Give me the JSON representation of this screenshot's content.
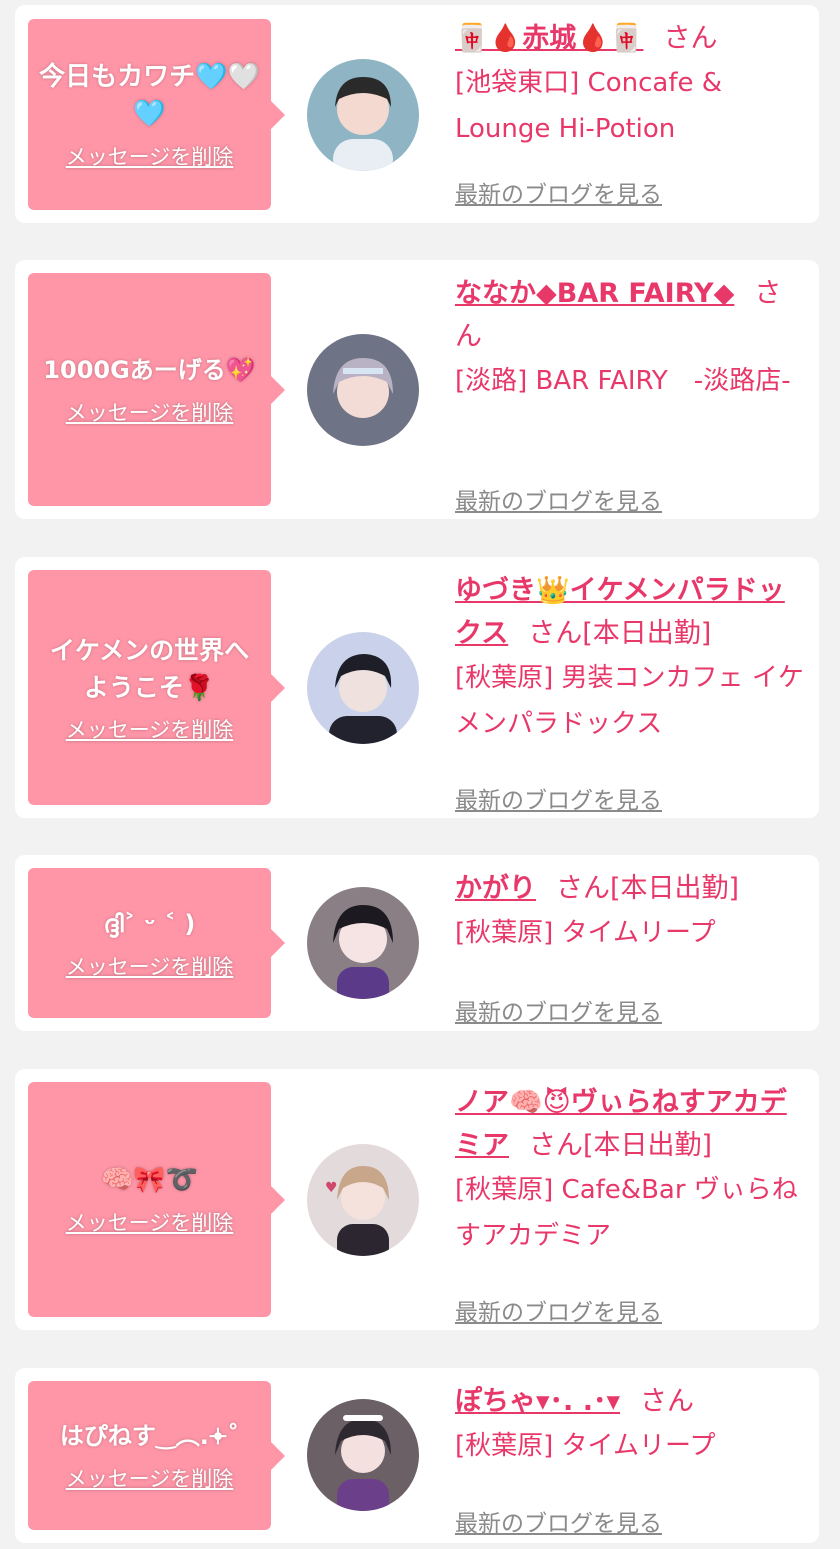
{
  "cards": [
    {
      "message": "今日もカワチ🩵🤍🩵",
      "delete_label": "メッセージを削除",
      "name": "🀄🩸赤城🩸🀄",
      "honorific": "さん",
      "badge": "",
      "shop": "[池袋東口] Concafe & Lounge Hi-Potion",
      "blog_label": "最新のブログを見る"
    },
    {
      "message": "1000Gあーげる💖",
      "delete_label": "メッセージを削除",
      "name": "ななか◆BAR FAIRY◆",
      "honorific": "さん",
      "badge": "",
      "shop": "[淡路] BAR FAIRY　-淡路店-",
      "blog_label": "最新のブログを見る"
    },
    {
      "message": "イケメンの世界へようこそ🌹",
      "delete_label": "メッセージを削除",
      "name": "ゆづき👑イケメンパラドックス",
      "honorific": "さん",
      "badge": "[本日出勤]",
      "shop": "[秋葉原] 男装コンカフェ イケメンパラドックス",
      "blog_label": "最新のブログを見る"
    },
    {
      "message": "ദ്ദി˃ ᵕ ˂ )",
      "delete_label": "メッセージを削除",
      "name": "かがり",
      "honorific": "さん",
      "badge": "[本日出勤]",
      "shop": "[秋葉原] タイムリープ",
      "blog_label": "最新のブログを見る"
    },
    {
      "message": "🧠🎀➰",
      "delete_label": "メッセージを削除",
      "name": "ノア🧠😈ヴぃらねすアカデミア",
      "honorific": "さん",
      "badge": "[本日出勤]",
      "shop": "[秋葉原] Cafe&Bar ヴぃらねすアカデミア",
      "blog_label": "最新のブログを見る"
    },
    {
      "message": "はぴねす‿︵.𖥔˚",
      "delete_label": "メッセージを削除",
      "name": "ぽちゃ▾･. .･▾",
      "honorific": "さん",
      "badge": "",
      "shop": "[秋葉原] タイムリープ",
      "blog_label": "最新のブログを見る"
    }
  ],
  "avatar_colors": [
    "#7fa3b8",
    "#8d8fa0",
    "#3a3d55",
    "#4a3b44",
    "#d9cfd0",
    "#3d3540"
  ]
}
